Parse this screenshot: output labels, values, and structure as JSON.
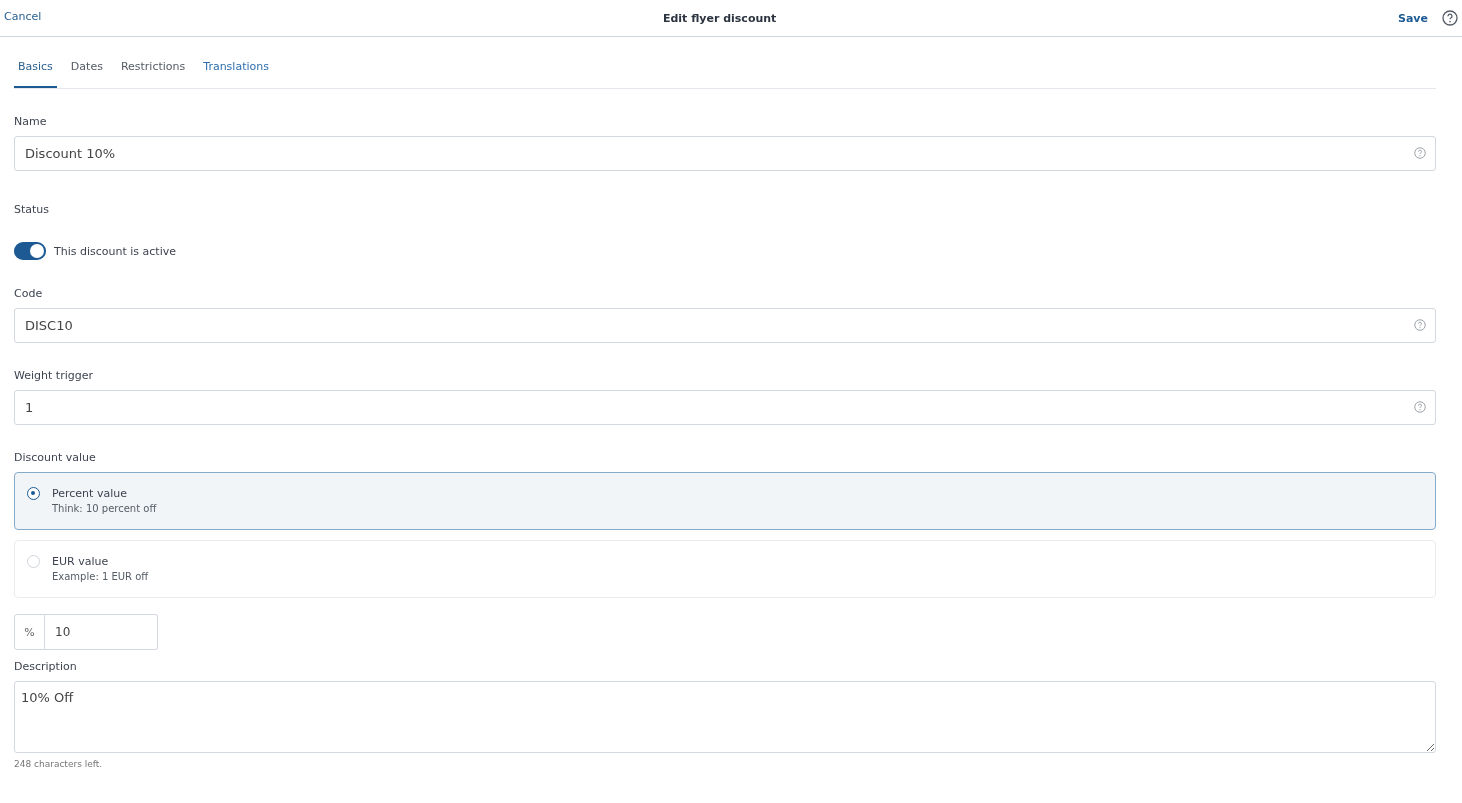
{
  "header": {
    "cancel": "Cancel",
    "title": "Edit flyer discount",
    "save": "Save"
  },
  "tabs": [
    {
      "label": "Basics",
      "selected": true,
      "hovered": false
    },
    {
      "label": "Dates",
      "selected": false,
      "hovered": false
    },
    {
      "label": "Restrictions",
      "selected": false,
      "hovered": false
    },
    {
      "label": "Translations",
      "selected": false,
      "hovered": true
    }
  ],
  "fields": [
    {
      "kind": "text",
      "label": "Name",
      "value": "Discount 10%"
    },
    {
      "kind": "toggle",
      "label": "Status",
      "text": "This discount is active",
      "on": true
    },
    {
      "kind": "text",
      "label": "Code",
      "value": "DISC10"
    },
    {
      "kind": "text",
      "label": "Weight trigger",
      "value": "1"
    },
    {
      "kind": "radio",
      "label": "Discount value",
      "options": [
        {
          "title": "Percent value",
          "hint": "Think: 10 percent off",
          "selected": true
        },
        {
          "title": "EUR value",
          "hint": "Example: 1 EUR off",
          "selected": false
        }
      ]
    },
    {
      "kind": "prefixed",
      "prefix": "%",
      "value": "10"
    },
    {
      "kind": "textarea",
      "label": "Description",
      "value": "10% Off",
      "note": "248 characters left."
    }
  ]
}
